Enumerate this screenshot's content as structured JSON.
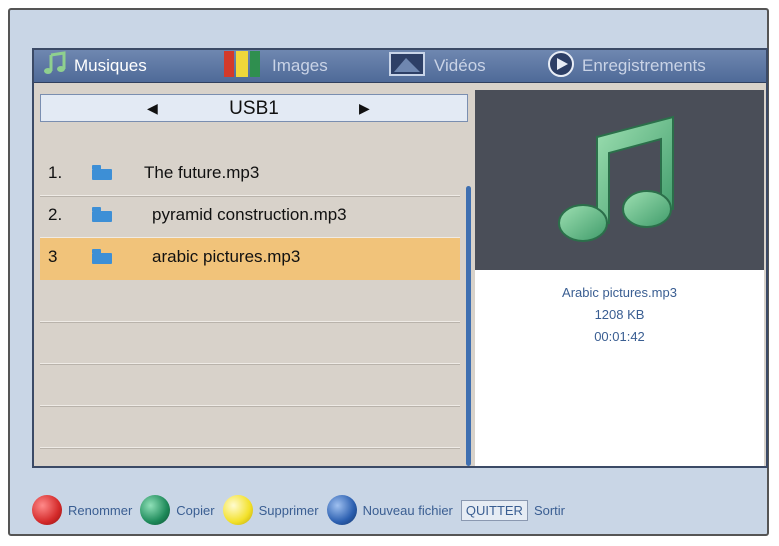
{
  "tabs": [
    {
      "label": "Musiques",
      "icon": "music-note-icon",
      "active": true
    },
    {
      "label": "Images",
      "icon": "palette-icon",
      "active": false
    },
    {
      "label": "Vidéos",
      "icon": "video-icon",
      "active": false
    },
    {
      "label": "Enregistrements",
      "icon": "record-icon",
      "active": false
    }
  ],
  "drive": {
    "name": "USB1",
    "prev_icon": "left-arrow-icon",
    "next_icon": "right-arrow-icon"
  },
  "files": [
    {
      "index": "1.",
      "name": "The future.mp3",
      "selected": false
    },
    {
      "index": "2.",
      "name": "pyramid construction.mp3",
      "selected": false
    },
    {
      "index": "3",
      "name": "arabic pictures.mp3",
      "selected": true
    }
  ],
  "preview": {
    "icon": "music-note-icon",
    "filename": "Arabic pictures.mp3",
    "size": "1208 KB",
    "duration": "00:01:42"
  },
  "footer": {
    "rename": "Renommer",
    "copy": "Copier",
    "delete": "Supprimer",
    "new_file": "Nouveau fichier",
    "quit_key": "QUITTER",
    "quit_label": "Sortir",
    "colors": {
      "red": "#d42a2a",
      "green": "#1e8a5a",
      "yellow": "#f3e12a",
      "blue": "#2b5fb0"
    }
  },
  "colors": {
    "tab_bar": "#5a74a3",
    "selection": "#f1c37a",
    "list_bg": "#d8d2ca",
    "preview_bg": "#4a4e58",
    "note_green": "#6fc08f"
  }
}
